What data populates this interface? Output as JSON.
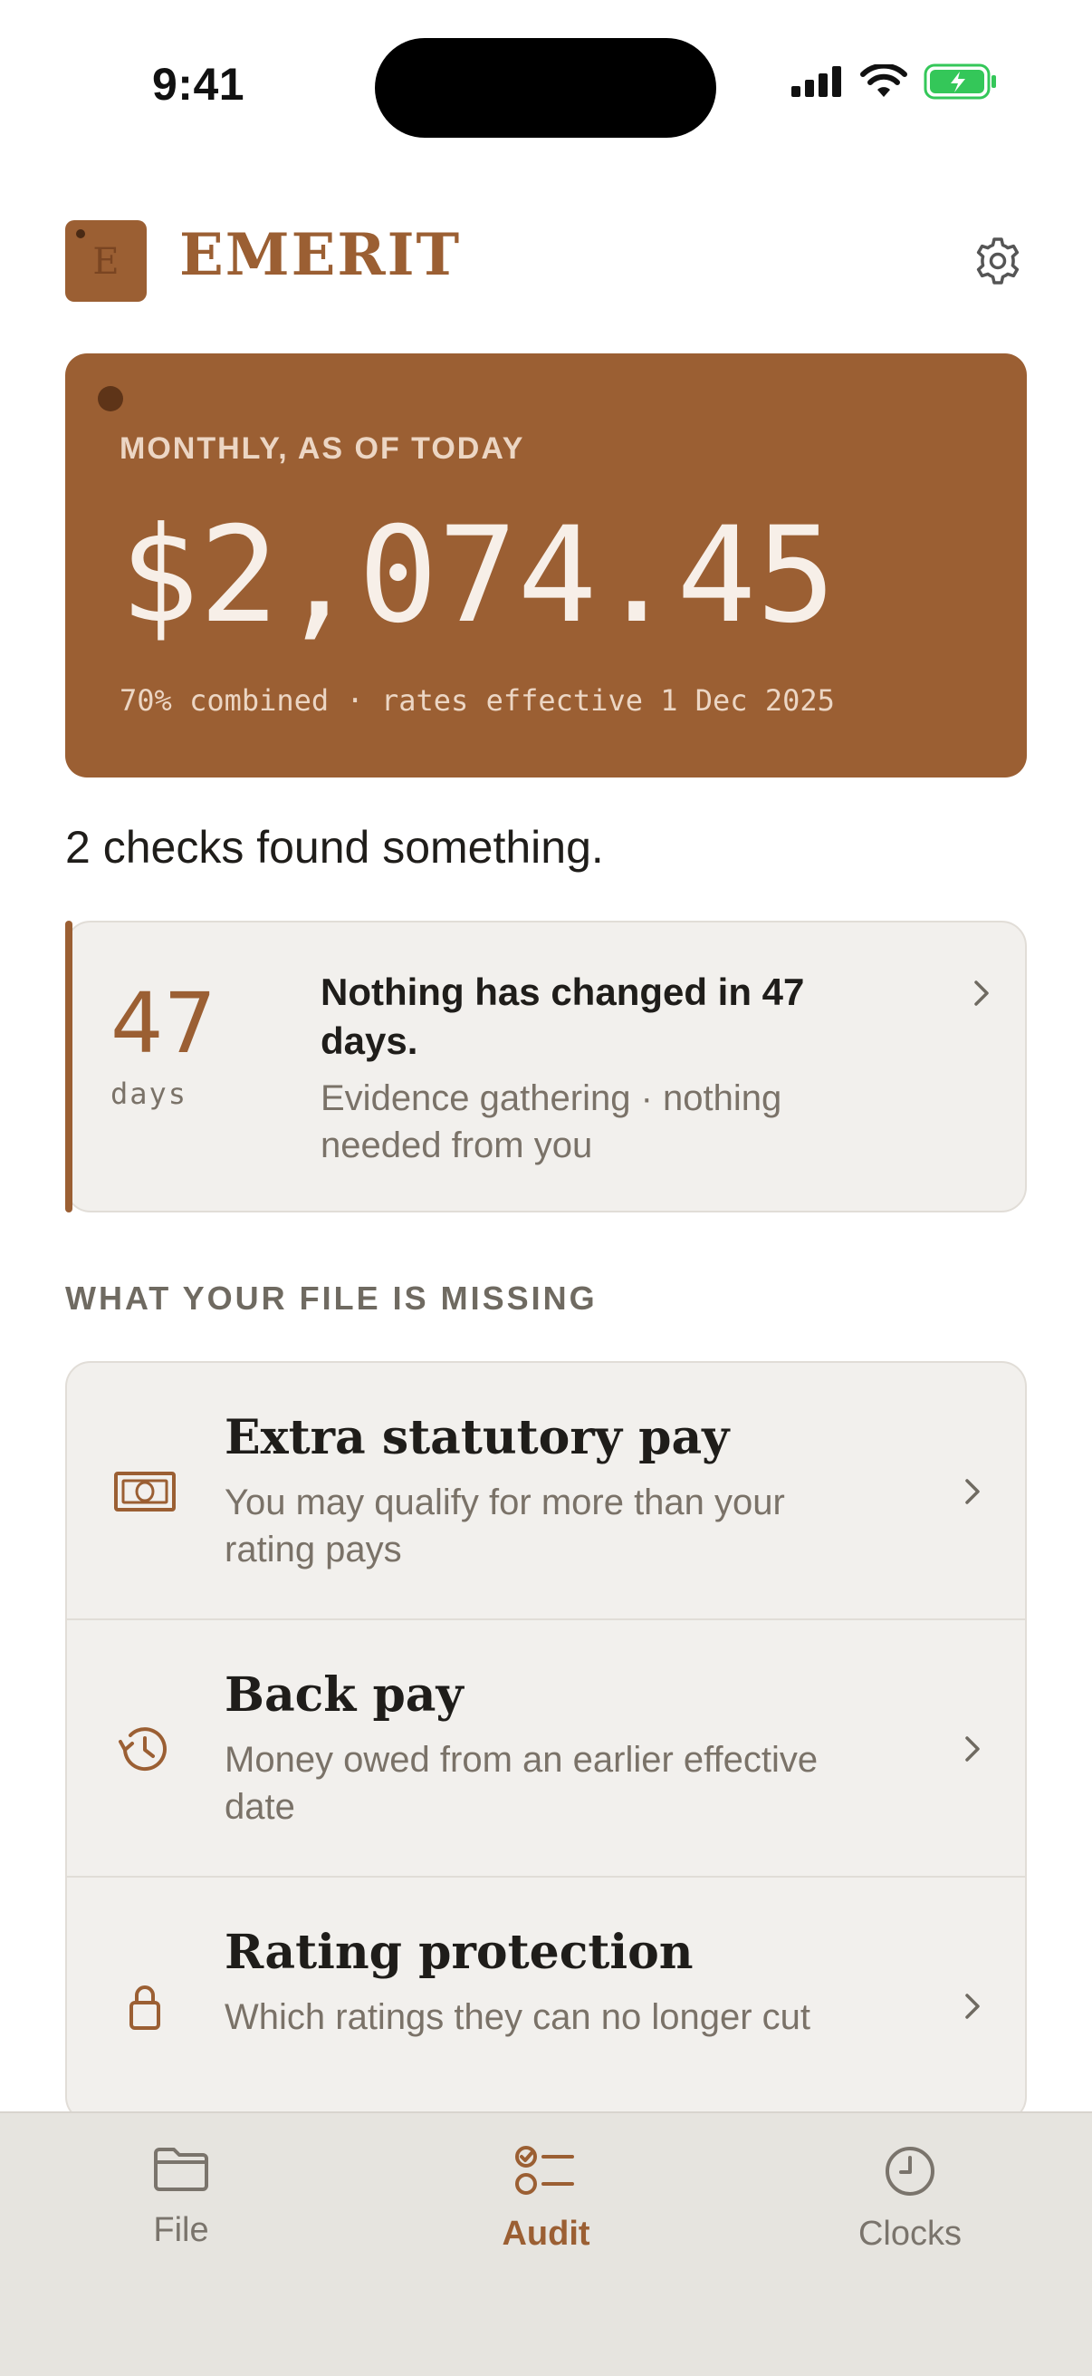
{
  "status_bar": {
    "time": "9:41"
  },
  "header": {
    "logo_letter": "E",
    "brand": "EMERIT"
  },
  "hero": {
    "label": "MONTHLY, AS OF TODAY",
    "amount": "$2,074.45",
    "subtitle": "70% combined · rates effective 1 Dec 2025"
  },
  "summary": "2 checks found something.",
  "evidence": {
    "number": "47",
    "unit": "days",
    "title": "Nothing has changed in 47 days.",
    "description": "Evidence gathering · nothing needed from you"
  },
  "missing": {
    "section_label": "WHAT YOUR FILE IS MISSING",
    "items": [
      {
        "title": "Extra statutory pay",
        "description": "You may qualify for more than your rating pays",
        "icon": "money-icon"
      },
      {
        "title": "Back pay",
        "description": "Money owed from an earlier effective date",
        "icon": "history-icon"
      },
      {
        "title": "Rating protection",
        "description": "Which ratings they can no longer cut",
        "icon": "lock-icon"
      }
    ]
  },
  "tabs": [
    {
      "label": "File",
      "icon": "folder-icon",
      "active": false
    },
    {
      "label": "Audit",
      "icon": "checklist-icon",
      "active": true
    },
    {
      "label": "Clocks",
      "icon": "clock-icon",
      "active": false
    }
  ],
  "colors": {
    "accent": "#9b5f33",
    "card": "#f2f0ed",
    "tabbar": "#e6e4df",
    "battery": "#34c759"
  }
}
